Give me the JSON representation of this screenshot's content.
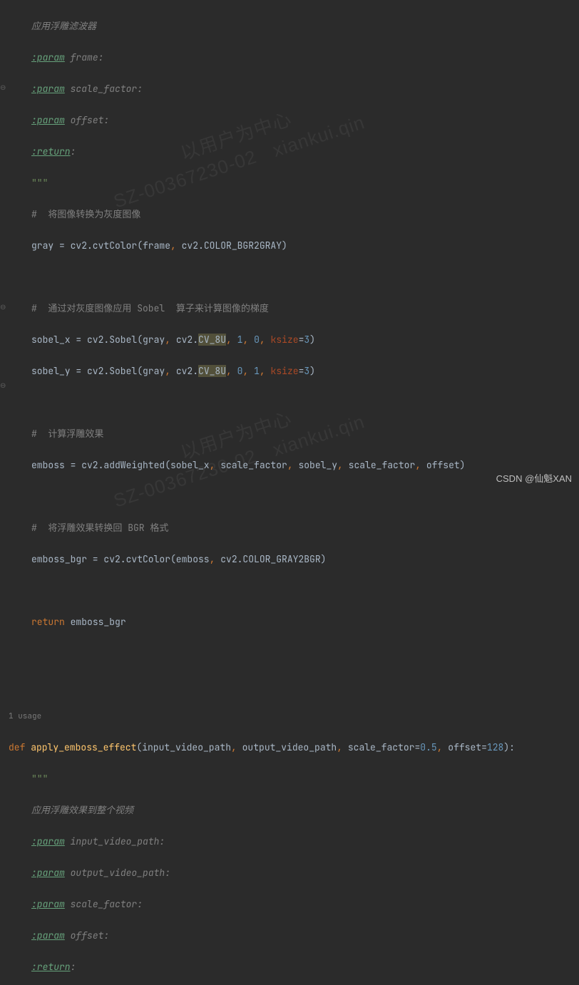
{
  "doc1": {
    "title": "应用浮雕滤波器",
    "p1": "frame:",
    "p2": "scale_factor:",
    "p3": "offset:",
    "ret": ":",
    "tag_param": ":param",
    "tag_return": ":return",
    "triple": "\"\"\""
  },
  "c1": "#  将图像转换为灰度图像",
  "l_gray": "gray = cv2.cvtColor(frame",
  "l_gray2": " cv2.COLOR_BGR2GRAY)",
  "c2a": "#  通过对灰度图像应用 ",
  "c2b": "Sobel",
  "c2c": "  算子来计算图像的梯度",
  "sx_a": "sobel_x = cv2.Sobel(gray",
  "sx_b": " cv2.",
  "sy_a": "sobel_y = cv2.Sobel(gray",
  "cv8u": "CV_8U",
  "ksize": "ksize",
  "n0": "0",
  "n1": "1",
  "n3": "3",
  "c3": "#  计算浮雕效果",
  "emb_a": "emboss = cv2.addWeighted(sobel_x",
  "emb_b": " scale_factor",
  "emb_c": " sobel_y",
  "emb_d": " scale_factor",
  "emb_e": " offset)",
  "c4": "#  将浮雕效果转换回 BGR 格式",
  "ebgr_a": "emboss_bgr = cv2.cvtColor(emboss",
  "ebgr_b": " cv2.COLOR_GRAY2BGR)",
  "ret_kw": "return",
  "ret_val": " emboss_bgr",
  "usage": "1 usage",
  "def_kw": "def ",
  "fn_name": "apply_emboss_effect",
  "sig_a": "(input_video_path",
  "sig_b": " output_video_path",
  "sig_sf": " scale_factor",
  "eq": "=",
  "v05": "0.5",
  "sig_off": " offset",
  "v128": "128",
  "sig_end": "):",
  "doc2": {
    "title": "应用浮雕效果到整个视频",
    "p1": "input_video_path:",
    "p2": "output_video_path:",
    "p3": "scale_factor:",
    "p4": "offset:"
  },
  "comma": ",",
  "wm1a": "以用户为中心",
  "wm1b": "SZ-00367230-02",
  "wm2": "xiankui.qin",
  "csdn": "CSDN @仙魁XAN"
}
